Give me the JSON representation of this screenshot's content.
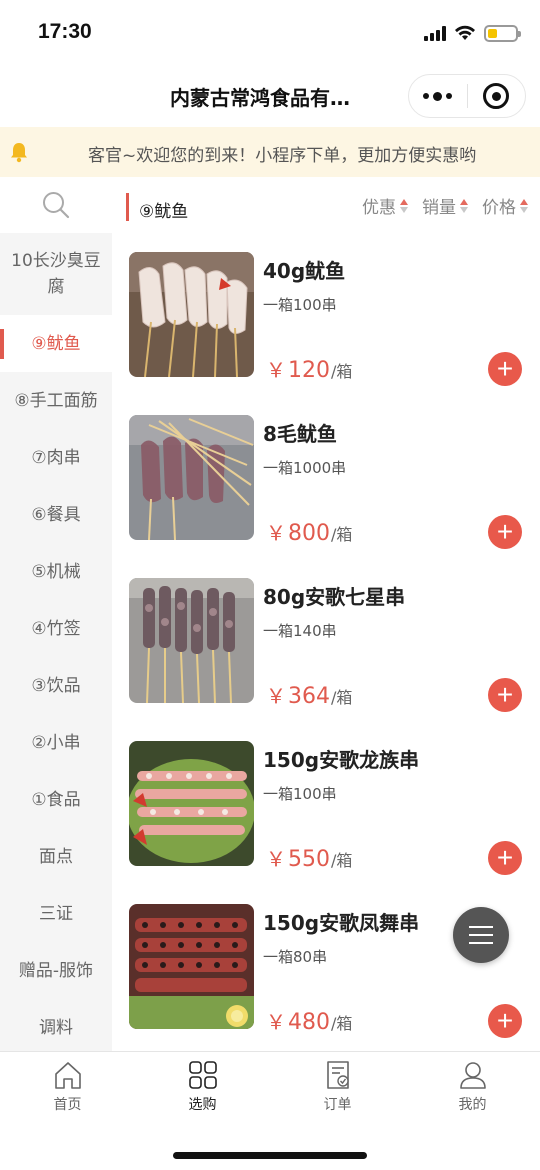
{
  "status_bar": {
    "time": "17:30"
  },
  "nav": {
    "title": "内蒙古常鸿食品有…"
  },
  "notice": {
    "text": "客官~欢迎您的到来！小程序下单，更加方便实惠哟"
  },
  "sidebar": {
    "items": [
      {
        "label": "10长沙臭豆腐"
      },
      {
        "label": "⑨鱿鱼"
      },
      {
        "label": "⑧手工面筋"
      },
      {
        "label": "⑦肉串"
      },
      {
        "label": "⑥餐具"
      },
      {
        "label": "⑤机械"
      },
      {
        "label": "④竹签"
      },
      {
        "label": "③饮品"
      },
      {
        "label": "②小串"
      },
      {
        "label": "①食品"
      },
      {
        "label": "面点"
      },
      {
        "label": "三证"
      },
      {
        "label": "赠品-服饰"
      },
      {
        "label": "调料"
      }
    ]
  },
  "content_header": {
    "section_title": "⑨鱿鱼",
    "sort_discount": "优惠",
    "sort_sales": "销量",
    "sort_price": "价格"
  },
  "products": [
    {
      "name": "40g鱿鱼",
      "spec": "一箱100串",
      "price": "120",
      "unit": "/箱"
    },
    {
      "name": "8毛鱿鱼",
      "spec": "一箱1000串",
      "price": "800",
      "unit": "/箱"
    },
    {
      "name": "80g安歌七星串",
      "spec": "一箱140串",
      "price": "364",
      "unit": "/箱"
    },
    {
      "name": "150g安歌龙族串",
      "spec": "一箱100串",
      "price": "550",
      "unit": "/箱"
    },
    {
      "name": "150g安歌凤舞串",
      "spec": "一箱80串",
      "price": "480",
      "unit": "/箱"
    }
  ],
  "currency_symbol": "￥",
  "tabs": [
    {
      "label": "首页"
    },
    {
      "label": "选购"
    },
    {
      "label": "订单"
    },
    {
      "label": "我的"
    }
  ],
  "colors": {
    "accent": "#e05a4e",
    "notice_bg": "#fdf6e3"
  }
}
